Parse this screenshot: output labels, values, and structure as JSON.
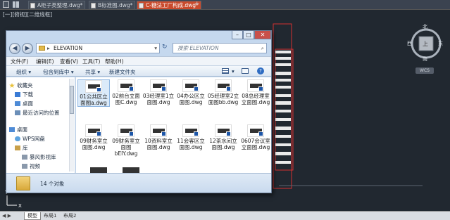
{
  "cad": {
    "file_tabs": [
      "A柜子类整理.dwg*",
      "B标准图.dwg*",
      "C-糖法工厂构成.dwg*"
    ],
    "view_label": "[一][俯视][二维线框]",
    "compass": {
      "n": "北",
      "s": "南",
      "e": "东",
      "w": "西",
      "center": "上"
    },
    "wcs": "WCS",
    "layout_tabs": [
      "模型",
      "布局1",
      "布局2"
    ]
  },
  "explorer": {
    "address": [
      "ELEVATION"
    ],
    "search_placeholder": "搜索 ELEVATION",
    "menu": [
      "文件(F)",
      "编辑(E)",
      "查看(V)",
      "工具(T)",
      "帮助(H)"
    ],
    "commands": [
      "组织 ▾",
      "包含到库中 ▾",
      "共享 ▾",
      "新建文件夹"
    ],
    "nav_items": [
      {
        "label": "收藏夹",
        "icon": "star-icon"
      },
      {
        "label": "下载",
        "icon": "download-folder-icon"
      },
      {
        "label": "桌面",
        "icon": "desktop-icon"
      },
      {
        "label": "最近访问的位置",
        "icon": "recent-places-icon"
      },
      {
        "label": "桌面",
        "icon": "desktop-icon"
      },
      {
        "label": "WPS网盘",
        "icon": "cloud-icon"
      },
      {
        "label": "库",
        "icon": "library-icon"
      },
      {
        "label": "暴风影视库",
        "icon": "video-folder-icon"
      },
      {
        "label": "视频",
        "icon": "video-folder-icon"
      }
    ],
    "files": [
      {
        "name": "01公共区立面图a.dwg"
      },
      {
        "name": "02前台立面图C.dwg"
      },
      {
        "name": "03经理室1立面图.dwg"
      },
      {
        "name": "04办公区立面图.dwg"
      },
      {
        "name": "05经理室2立面图bb.dwg"
      },
      {
        "name": "08总经理室立面图.dwg"
      },
      {
        "name": "09财务室立面图.dwg"
      },
      {
        "name": "09财务室立面图bEIY.dwg"
      },
      {
        "name": "10资料室立面图.dwg"
      },
      {
        "name": "11会客区立面图.dwg"
      },
      {
        "name": "12茶水间立面图.dwg"
      },
      {
        "name": "0607会议室立面图.dwg"
      }
    ],
    "status": "14 个对象"
  }
}
